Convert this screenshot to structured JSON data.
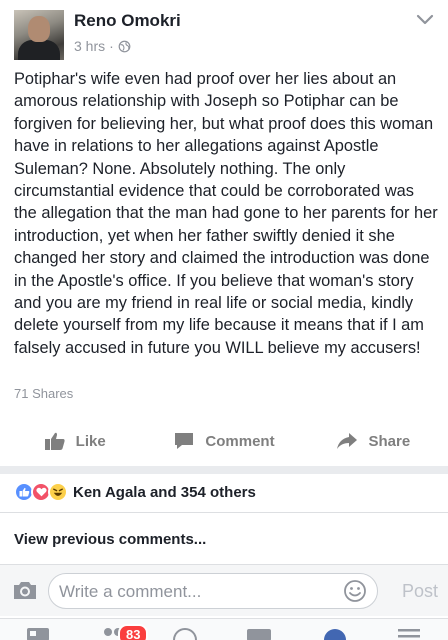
{
  "post": {
    "author": "Reno Omokri",
    "time": "3 hrs",
    "separator": "·",
    "body": "Potiphar's wife even had proof over her lies about an amorous relationship with Joseph so Potiphar can be forgiven for believing her, but what proof does this woman have in relations to her allegations against Apostle Suleman? None. Absolutely nothing. The only circumstantial evidence that could be corroborated was the allegation that the man had gone to her parents for her introduction, yet when her father swiftly denied it she changed her story and claimed the introduction was done in the Apostle's office. If you believe that woman's story and you are my friend in real life or social media, kindly delete yourself from my life because it means that if I am falsely accused in future you WILL believe my accusers!",
    "shares": "71 Shares"
  },
  "actions": {
    "like": "Like",
    "comment": "Comment",
    "share": "Share"
  },
  "reactions": {
    "text": "Ken Agala and 354 others",
    "icons": [
      "like-reaction-icon",
      "love-reaction-icon",
      "haha-reaction-icon"
    ]
  },
  "comments": {
    "view_previous": "View previous comments...",
    "placeholder": "Write a comment...",
    "post_label": "Post"
  },
  "tabbar": {
    "notification_count": "83"
  },
  "colors": {
    "brand_blue": "#4267b2",
    "muted_text": "#90949c",
    "badge_red": "#fa3e3e"
  }
}
